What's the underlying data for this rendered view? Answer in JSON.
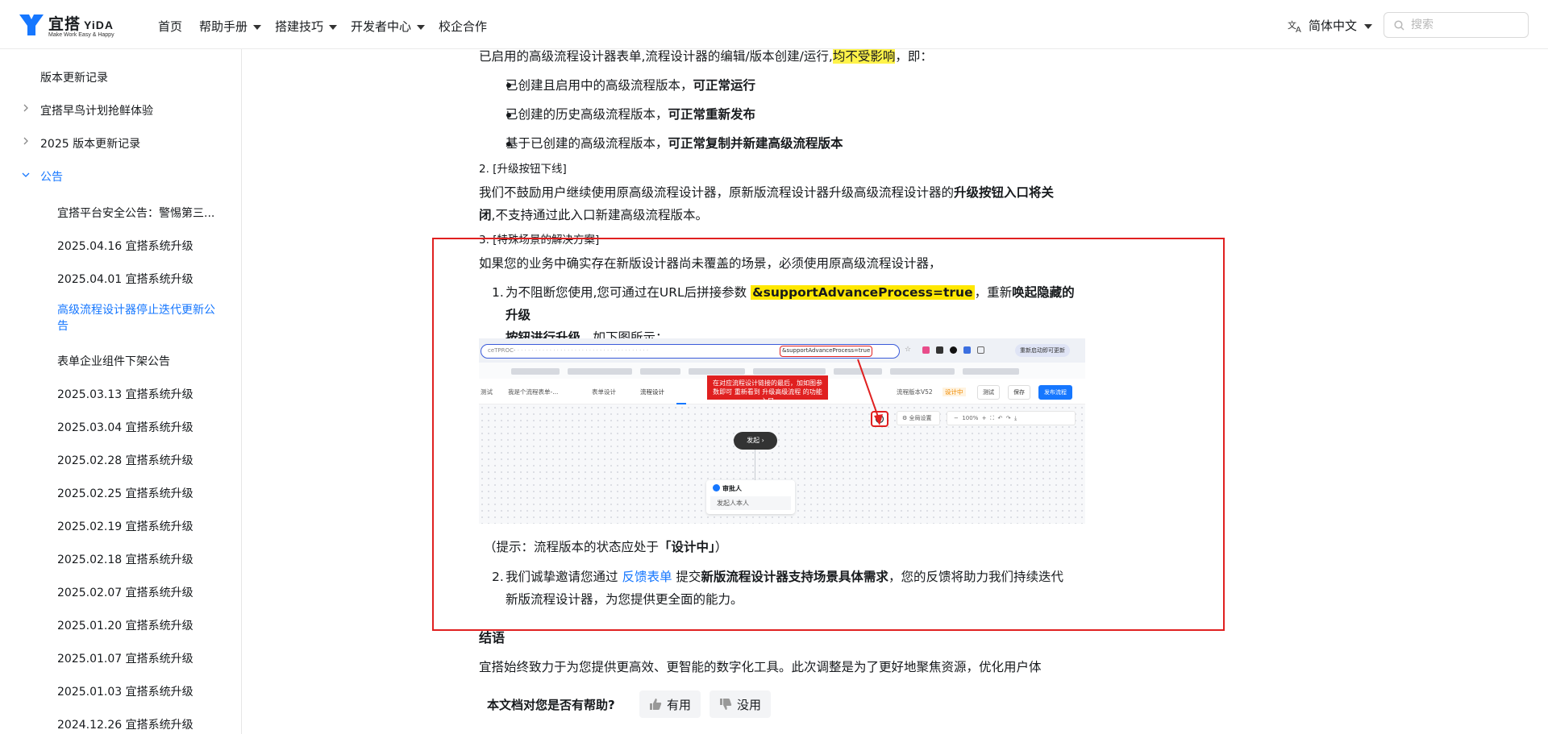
{
  "header": {
    "logo_main": "宜搭",
    "logo_en": "YiDA",
    "logo_sub": "Make Work Easy & Happy",
    "nav": [
      {
        "label": "首页",
        "has_caret": false
      },
      {
        "label": "帮助手册",
        "has_caret": true
      },
      {
        "label": "搭建技巧",
        "has_caret": true
      },
      {
        "label": "开发者中心",
        "has_caret": true
      },
      {
        "label": "校企合作",
        "has_caret": false
      }
    ],
    "language": "简体中文",
    "search_placeholder": "搜索"
  },
  "sidebar": {
    "items": [
      {
        "label": "版本更新记录"
      },
      {
        "label": "宜搭早鸟计划抢鲜体验"
      },
      {
        "label": "2025 版本更新记录"
      },
      {
        "label": "公告"
      },
      {
        "label": "宜搭平台安全公告：警惕第三..."
      },
      {
        "label": "2025.04.16 宜搭系统升级"
      },
      {
        "label": "2025.04.01 宜搭系统升级"
      },
      {
        "label": "高级流程设计器停止迭代更新公告"
      },
      {
        "label": "表单企业组件下架公告"
      },
      {
        "label": "2025.03.13 宜搭系统升级"
      },
      {
        "label": "2025.03.04 宜搭系统升级"
      },
      {
        "label": "2025.02.28 宜搭系统升级"
      },
      {
        "label": "2025.02.25 宜搭系统升级"
      },
      {
        "label": "2025.02.19 宜搭系统升级"
      },
      {
        "label": "2025.02.18 宜搭系统升级"
      },
      {
        "label": "2025.02.07 宜搭系统升级"
      },
      {
        "label": "2025.01.20 宜搭系统升级"
      },
      {
        "label": "2025.01.07 宜搭系统升级"
      },
      {
        "label": "2025.01.03 宜搭系统升级"
      },
      {
        "label": "2024.12.26 宜搭系统升级"
      }
    ]
  },
  "content": {
    "intro_a": "已启用的高级流程设计器表单,流程设计器的编辑/版本创建/运行,",
    "intro_hl": "均不受影响",
    "intro_b": "，即：",
    "bullets": [
      {
        "a": "已创建且启用中的高级流程版本，",
        "b": "可正常运行"
      },
      {
        "a": "已创建的历史高级流程版本，",
        "b": "可正常重新发布"
      },
      {
        "a": "基于已创建的高级流程版本，",
        "b": "可正常复制并新建高级流程版本"
      }
    ],
    "sec2_title": "2. [升级按钮下线]",
    "sec2_a": "我们不鼓励用户继续使用原高级流程设计器，原新版流程设计器升级高级流程设计器的",
    "sec2_b": "升级按钮入口将关",
    "sec2_c": "闭",
    "sec2_d": ",不支持通过此入口新建高级流程版本。",
    "sec3_title": "3. [特殊场景的解决方案]",
    "sec3_intro": "如果您的业务中确实存在新版设计器尚未覆盖的场景，必须使用原高级流程设计器，",
    "step1_num": "1.",
    "step1_a": "为不阻断您使用,您可通过在URL后拼接参数",
    "step1_code": "&supportAdvanceProcess=true",
    "step1_b": "，重新",
    "step1_c": "唤起隐藏的升级",
    "step1_d": "按钮进行升级。",
    "step1_e": "如下图所示：",
    "tip_a": "（提示：流程版本的状态应处于",
    "tip_b": "「设计中」",
    "tip_c": "）",
    "step2_num": "2.",
    "step2_a": "我们诚挚邀请您通过",
    "step2_link": "反馈表单",
    "step2_b": "提交",
    "step2_c": "新版流程设计器支持场景具体需求",
    "step2_d": "，您的反馈将助力我们持续迭代",
    "step2_e": "新版流程设计器，为您提供更全面的能力。",
    "conclusion_title": "结语",
    "conclusion_text": "宜搭始终致力于为您提供更高效、更智能的数字化工具。此次调整是为了更好地聚焦资源，优化用户体",
    "helpful_q": "本文档对您是否有帮助?",
    "useful": "有用",
    "useless": "没用"
  },
  "screenshot": {
    "url_prefix": "ceTPROC-",
    "url_param": "&supportAdvanceProcess=true",
    "restart_btn": "重新启动即可更新",
    "breadcrumb_a": "测试",
    "breadcrumb_b": "我是个流程表单-...",
    "tab_form": "表单设计",
    "tab_flow": "流程设计",
    "version": "流程版本V52",
    "version_status": "设计中",
    "btn_test": "测试",
    "btn_save": "保存",
    "btn_publish": "发布流程",
    "callout": "在对应流程设计链接的最后，加如图参数即可 重新看到 升级高级流程 的功能入口",
    "global_settings": "全局设置",
    "zoom": "100%",
    "start_node": "发起",
    "approver": "审批人",
    "approver_sub": "发起人本人"
  },
  "colors": {
    "accent": "#1677ff",
    "highlight": "#fff34a",
    "callout_red": "#e02020"
  }
}
